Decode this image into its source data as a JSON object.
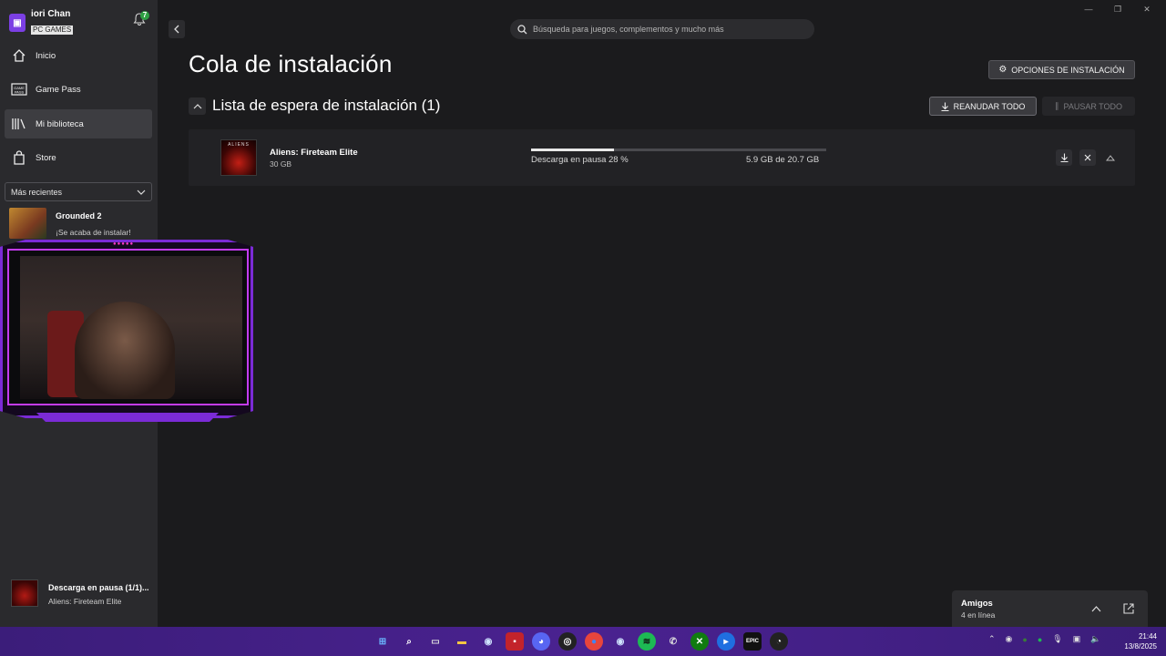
{
  "sidebar": {
    "user_name": "iori Chan",
    "user_tier": "PC GAMES",
    "notification_count": "7",
    "nav": [
      {
        "label": "Inicio",
        "icon": "home-icon"
      },
      {
        "label": "Game Pass",
        "icon": "gamepass-icon"
      },
      {
        "label": "Mi biblioteca",
        "icon": "library-icon"
      },
      {
        "label": "Store",
        "icon": "store-bag-icon"
      }
    ],
    "sort_value": "Más recientes",
    "recent": {
      "title": "Grounded 2",
      "subtitle": "¡Se acaba de instalar!"
    },
    "download_status": {
      "title": "Descarga en pausa (1/1)...",
      "subtitle": "Aliens: Fireteam Elite"
    }
  },
  "header": {
    "search_placeholder": "Búsqueda para juegos, complementos y mucho más",
    "page_title": "Cola de instalación",
    "install_options_label": "OPCIONES DE INSTALACIÓN"
  },
  "queue": {
    "section_title": "Lista de espera de instalación (1)",
    "resume_all_label": "REANUDAR TODO",
    "pause_all_label": "PAUSAR TODO",
    "items": [
      {
        "thumb_text": "ALIENS",
        "title": "Aliens: Fireteam Elite",
        "size": "30 GB",
        "status": "Descarga en pausa 28 %",
        "progress_percent": 28,
        "amount": "5.9 GB de 20.7 GB"
      }
    ]
  },
  "friends": {
    "title": "Amigos",
    "online": "4 en línea"
  },
  "taskbar": {
    "time": "21:44",
    "date": "13/8/2025",
    "pinned": [
      "windows-start-icon",
      "search-icon",
      "task-view-icon",
      "file-explorer-icon",
      "steam-icon",
      "app-red-icon",
      "discord-icon",
      "obs-icon",
      "chrome-icon",
      "steam-icon",
      "spotify-icon",
      "whatsapp-icon",
      "xbox-icon",
      "app-blue-icon",
      "epic-games-icon",
      "obs-studio-icon"
    ]
  },
  "colors": {
    "accent_purple": "#7b3fe4",
    "badge_green": "#2ea043",
    "taskbar": "#4a2290"
  }
}
